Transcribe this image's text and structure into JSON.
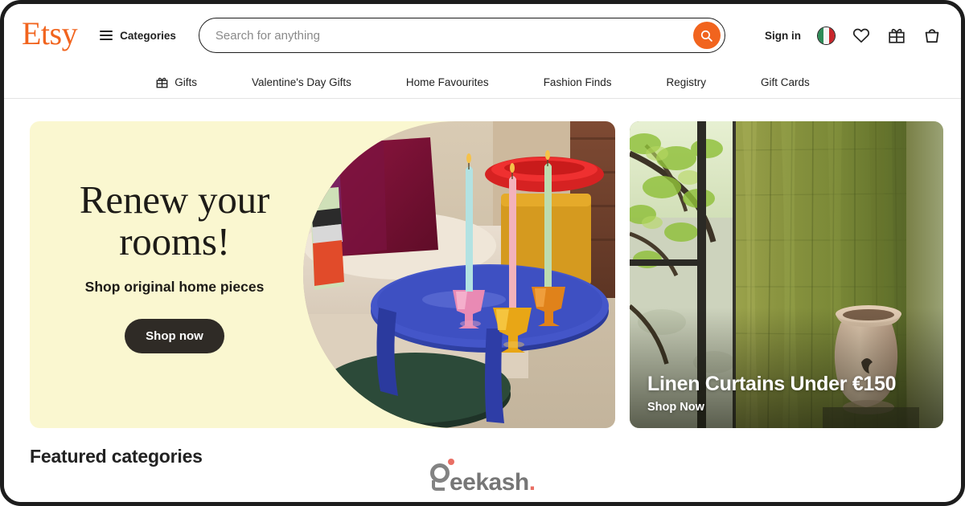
{
  "brand": {
    "logo_text": "Etsy",
    "logo_color": "#F1641E"
  },
  "header": {
    "categories_label": "Categories",
    "search": {
      "placeholder": "Search for anything",
      "value": "",
      "submit_icon": "search-icon"
    },
    "sign_in_label": "Sign in",
    "locale_flag": {
      "name": "italy-flag-icon",
      "stripes": [
        "#2E8B57",
        "#F5F5F5",
        "#C8262B"
      ]
    },
    "icons": [
      {
        "name": "heart-icon",
        "label": "Favourites"
      },
      {
        "name": "gift-icon",
        "label": "Gift mode"
      },
      {
        "name": "cart-icon",
        "label": "Cart"
      }
    ]
  },
  "nav": {
    "items": [
      {
        "label": "Gifts",
        "icon": "gift-icon"
      },
      {
        "label": "Valentine's Day Gifts",
        "icon": ""
      },
      {
        "label": "Home Favourites",
        "icon": ""
      },
      {
        "label": "Fashion Finds",
        "icon": ""
      },
      {
        "label": "Registry",
        "icon": ""
      },
      {
        "label": "Gift Cards",
        "icon": ""
      }
    ]
  },
  "hero_left": {
    "headline_line1": "Renew your",
    "headline_line2": "rooms!",
    "subheadline": "Shop original home pieces",
    "cta_label": "Shop now",
    "background_color": "#FAF7D0",
    "cta_background": "#2F2B26",
    "image_alt": "Twisted taper candles in coloured glass holders on a blue side table"
  },
  "hero_right": {
    "title": "Linen Curtains Under €150",
    "cta_label": "Shop Now",
    "image_alt": "Olive green linen curtain by a window with terracotta vase"
  },
  "bottom": {
    "featured_heading": "Featured categories"
  },
  "watermark": {
    "wordmark": "eekash",
    "period": ".",
    "mark_color": "#7D7D7D",
    "accent_color": "#E8685C"
  }
}
